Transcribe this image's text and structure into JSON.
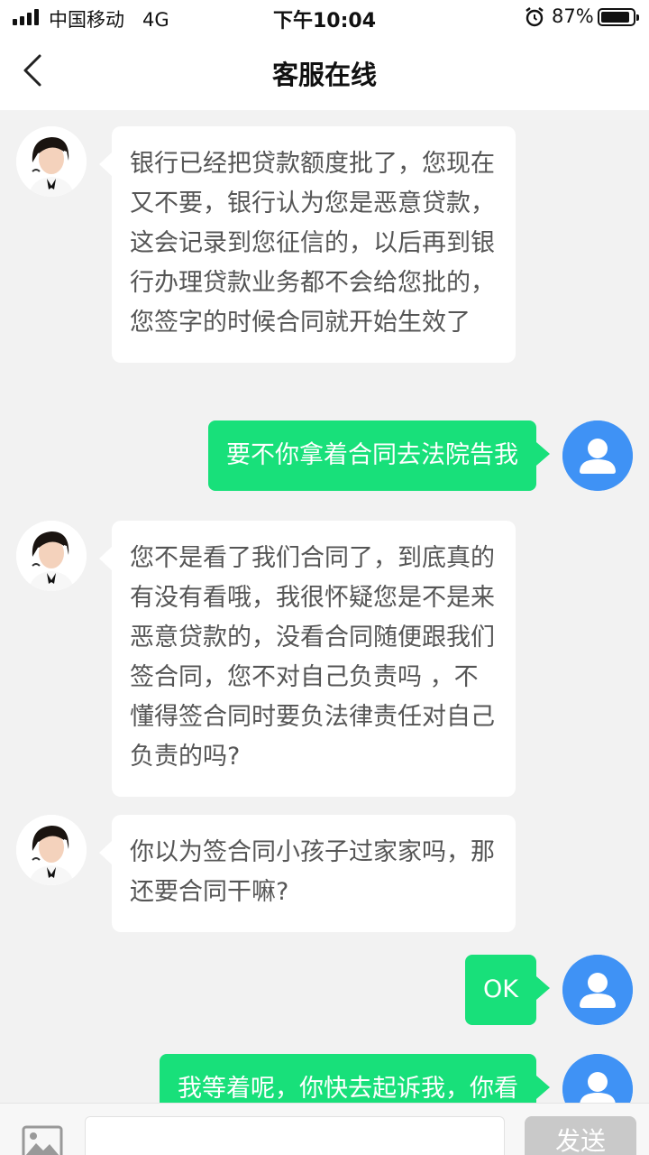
{
  "status_bar": {
    "carrier": "中国移动   4G",
    "time": "下午10:04",
    "battery_percent": "87%",
    "icons": [
      "signal-icon",
      "alarm-icon",
      "battery-icon"
    ]
  },
  "nav": {
    "back_icon": "chevron-left-icon",
    "title": "客服在线"
  },
  "messages": [
    {
      "sender": "agent",
      "text": "银行已经把贷款额度批了，您现在又不要，银行认为您是恶意贷款，这会记录到您征信的，以后再到银行办理贷款业务都不会给您批的，您签字的时候合同就开始生效了"
    },
    {
      "sender": "user",
      "text": "要不你拿着合同去法院告我"
    },
    {
      "sender": "agent",
      "text": "您不是看了我们合同了，到底真的有没有看哦，我很怀疑您是不是来恶意贷款的，没看合同随便跟我们签合同，您不对自己负责吗 ，不懂得签合同时要负法律责任对自己负责的吗?"
    },
    {
      "sender": "agent",
      "text": "你以为签合同小孩子过家家吗，那还要合同干嘛?"
    },
    {
      "sender": "user",
      "text": "OK"
    },
    {
      "sender": "user",
      "text": "我等着呢，你快去起诉我，你看"
    }
  ],
  "input_bar": {
    "image_icon": "image-icon",
    "input_value": "",
    "send_label": "发送"
  },
  "colors": {
    "user_bubble": "#18e07a",
    "agent_bubble": "#ffffff",
    "user_avatar": "#3f92f5",
    "background": "#f2f2f2",
    "send_button_disabled": "#c9c9c9"
  }
}
